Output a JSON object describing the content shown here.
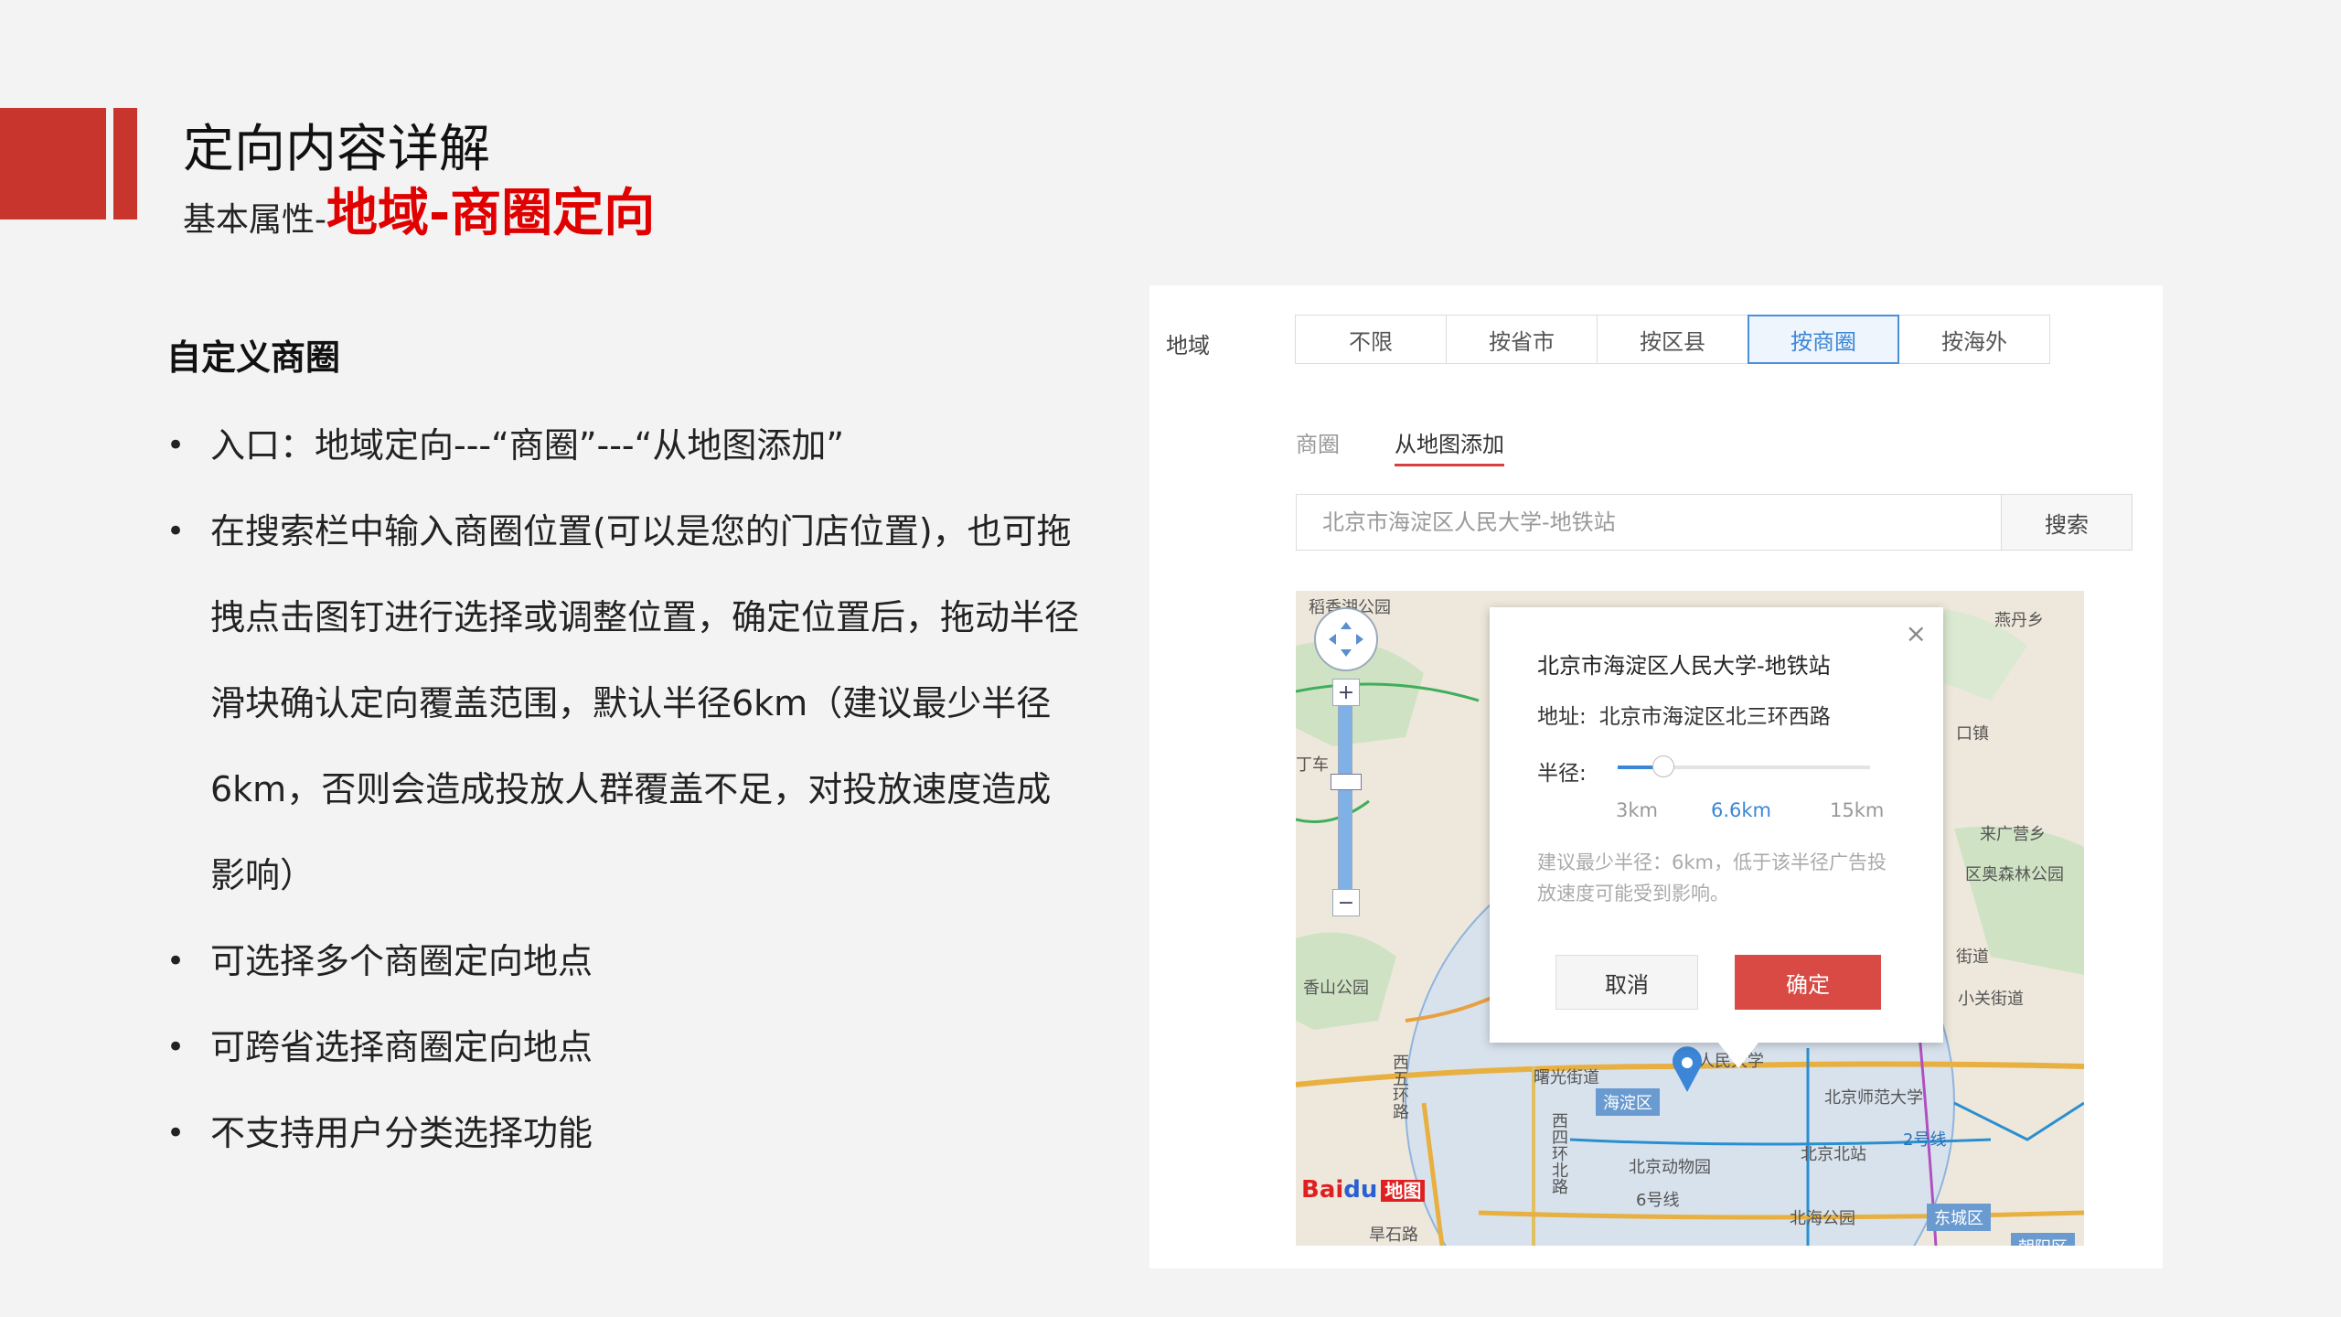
{
  "slide": {
    "title": "定向内容详解",
    "subtitle_prefix": "基本属性-",
    "subtitle_highlight": "地域-商圈定向",
    "accent_color": "#c8352c",
    "highlight_color": "#e00000"
  },
  "content": {
    "section_title": "自定义商圈",
    "bullets": [
      "入口：地域定向---“商圈”---“从地图添加”",
      "在搜索栏中输入商圈位置(可以是您的门店位置)，也可拖拽点击图钉进行选择或调整位置，确定位置后，拖动半径滑块确认定向覆盖范围，默认半径6km（建议最少半径6km，否则会造成投放人群覆盖不足，对投放速度造成影响）",
      "可选择多个商圈定向地点",
      "可跨省选择商圈定向地点",
      "不支持用户分类选择功能"
    ]
  },
  "ui": {
    "region_label": "地域",
    "tabs": [
      "不限",
      "按省市",
      "按区县",
      "按商圈",
      "按海外"
    ],
    "active_tab": "按商圈",
    "subtabs": [
      "商圈",
      "从地图添加"
    ],
    "active_subtab": "从地图添加",
    "search": {
      "placeholder": "北京市海淀区人民大学-地铁站",
      "button": "搜索"
    },
    "popup": {
      "close": "×",
      "title": "北京市海淀区人民大学-地铁站",
      "address_label": "地址:",
      "address": "北京市海淀区北三环西路",
      "radius_label": "半径:",
      "slider": {
        "min_label": "3km",
        "current_label": "6.6km",
        "max_label": "15km",
        "value_fraction": 0.18
      },
      "note": "建议最少半径：6km，低于该半径广告投放速度可能受到影响。",
      "cancel": "取消",
      "confirm": "确定"
    },
    "map": {
      "labels": {
        "park1": "稻香湖公园",
        "town1": "燕丹乡",
        "l_che": "丁车",
        "town2": "口镇",
        "l_laiguangying": "来广营乡",
        "l_forest": "区奥森林公园",
        "l_jiedao1": "街道",
        "l_xiaoguan": "小关街道",
        "xiangshan": "香山公园",
        "ring5": "西五环路",
        "shuguang": "曙光街道",
        "haidian": "海淀区",
        "renmin": "人民大学",
        "shida": "北京师范大学",
        "beijingbei": "北京北站",
        "line2": "2号线",
        "line6": "6号线",
        "ring4": "西四环北路",
        "zoo": "北京动物园",
        "beihai": "北海公园",
        "dongcheng": "东城区",
        "chaoyang": "朝阳区",
        "shijing": "旱石路"
      },
      "zoom_in": "+",
      "zoom_out": "−",
      "logo_bai": "Bai",
      "logo_du": "du",
      "logo_ditu": "地图"
    }
  }
}
